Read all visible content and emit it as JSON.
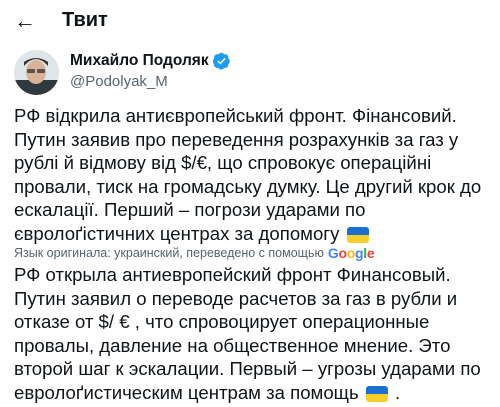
{
  "header": {
    "back_icon": "arrow-left-icon",
    "title": "Твит"
  },
  "author": {
    "name": "Михайло Подоляк",
    "handle": "@Podolyak_M",
    "verified_icon": "verified-badge-icon",
    "verified_color": "#1d9bf0"
  },
  "tweet": {
    "text_uk": "РФ відкрила антиєвропейський фронт. Фінансовий. Путин заявив про переведення розрахунків за газ у рублі й відмову від $/€, що спровокує операційні провали, тиск на громадську думку. Це другий крок до ескалації. Перший – погрози ударами по євролоґістичних центрах за допомогу",
    "text_ru": "РФ открыла антиевропейский фронт Финансовый. Путин заявил о переводе расчетов за газ в рубли и отказе от $/ € , что спровоцирует операционные провалы, давление на общественное мнение. Это второй шаг к эскалации. Первый – угрозы ударами по евролоґистическим центрам за помощь",
    "ending_ru": " .",
    "translation_note": "Язык оригинала: украинский, переведено с помощью",
    "translation_provider": "Google",
    "flag_icon": "ukraine-flag-icon"
  }
}
